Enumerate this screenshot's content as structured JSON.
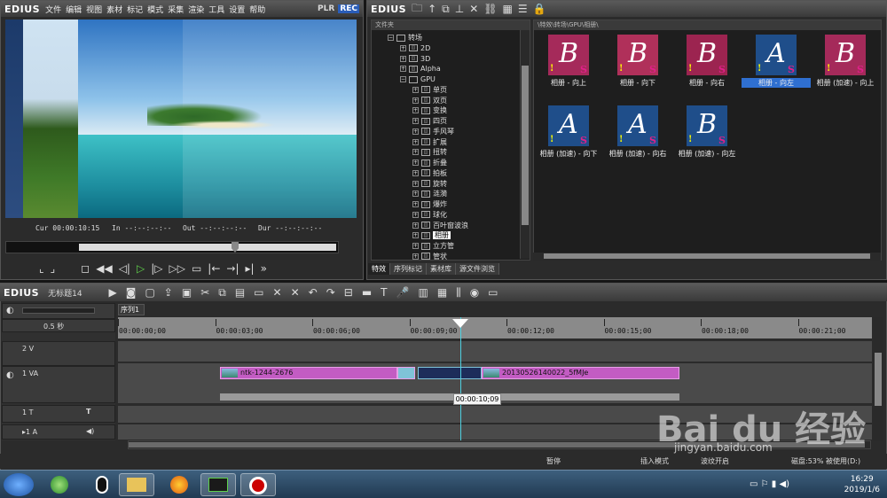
{
  "player": {
    "logo": "EDIUS",
    "menu": [
      "文件",
      "编辑",
      "视图",
      "素材",
      "标记",
      "模式",
      "采集",
      "渲染",
      "工具",
      "设置",
      "帮助"
    ],
    "plr": "PLR",
    "rec": "REC",
    "cur_label": "Cur",
    "cur": "00:00:10:15",
    "in_label": "In",
    "in": "--:--:--:--",
    "out_label": "Out",
    "out": "--:--:--:--",
    "dur_label": "Dur",
    "dur": "--:--:--:--"
  },
  "bin": {
    "logo": "EDIUS",
    "folder_header": "文件夹",
    "path": "\\特效\\转场\\GPU\\相册\\",
    "tree": [
      {
        "label": "转场",
        "indent": 0,
        "type": "folder"
      },
      {
        "label": "2D",
        "indent": 1,
        "type": "item"
      },
      {
        "label": "3D",
        "indent": 1,
        "type": "item"
      },
      {
        "label": "Alpha",
        "indent": 1,
        "type": "item"
      },
      {
        "label": "GPU",
        "indent": 1,
        "type": "folder"
      },
      {
        "label": "单页",
        "indent": 2,
        "type": "item"
      },
      {
        "label": "双页",
        "indent": 2,
        "type": "item"
      },
      {
        "label": "变换",
        "indent": 2,
        "type": "item"
      },
      {
        "label": "四页",
        "indent": 2,
        "type": "item"
      },
      {
        "label": "手风琴",
        "indent": 2,
        "type": "item"
      },
      {
        "label": "扩展",
        "indent": 2,
        "type": "item"
      },
      {
        "label": "扭转",
        "indent": 2,
        "type": "item"
      },
      {
        "label": "折叠",
        "indent": 2,
        "type": "item"
      },
      {
        "label": "拍板",
        "indent": 2,
        "type": "item"
      },
      {
        "label": "旋转",
        "indent": 2,
        "type": "item"
      },
      {
        "label": "涟漪",
        "indent": 2,
        "type": "item"
      },
      {
        "label": "爆炸",
        "indent": 2,
        "type": "item"
      },
      {
        "label": "球化",
        "indent": 2,
        "type": "item"
      },
      {
        "label": "百叶窗波浪",
        "indent": 2,
        "type": "item"
      },
      {
        "label": "相册",
        "indent": 2,
        "type": "item",
        "selected": true
      },
      {
        "label": "立方管",
        "indent": 2,
        "type": "item"
      },
      {
        "label": "管状",
        "indent": 2,
        "type": "item"
      }
    ],
    "clips": [
      {
        "label": "相册 - 向上",
        "letter": "B",
        "bg": "#a52a5a",
        "sel": false
      },
      {
        "label": "相册 - 向下",
        "letter": "B",
        "bg": "#b0305a",
        "sel": false
      },
      {
        "label": "相册 - 向右",
        "letter": "B",
        "bg": "#9c2450",
        "sel": false
      },
      {
        "label": "相册 - 向左",
        "letter": "A",
        "bg": "#1f4e8a",
        "sel": true
      },
      {
        "label": "相册 (加速) - 向上",
        "letter": "B",
        "bg": "#a52a5a",
        "sel": false
      },
      {
        "label": "相册 (加速) - 向下",
        "letter": "A",
        "bg": "#1f4e8a",
        "sel": false
      },
      {
        "label": "相册 (加速) - 向右",
        "letter": "A",
        "bg": "#1f4e8a",
        "sel": false
      },
      {
        "label": "相册 (加速) - 向左",
        "letter": "B",
        "bg": "#1f4e8a",
        "sel": false
      }
    ],
    "tabs": [
      "特效",
      "序列标记",
      "素材库",
      "源文件浏览"
    ]
  },
  "timeline": {
    "logo": "EDIUS",
    "title": "无标题14",
    "seq_tab": "序列1",
    "scale": "0.5 秒",
    "ruler": [
      "00:00:00;00",
      "00:00:03;00",
      "00:00:06;00",
      "00:00:09;00",
      "00:00:12;00",
      "00:00:15;00",
      "00:00:18;00",
      "00:00:21;00"
    ],
    "tracks": [
      {
        "name": "2 V"
      },
      {
        "name": "1 VA"
      },
      {
        "name": "1 T"
      },
      {
        "name": "▸1 A"
      }
    ],
    "clip1": "ntk-1244-2676",
    "clip2": "20130526140022_5fMJe",
    "tooltip": "00:00:10;09"
  },
  "status": {
    "pause": "暂停",
    "insert": "插入模式",
    "ripple": "波纹开启",
    "disk": "磁盘:53% 被使用(D:)"
  },
  "taskbar": {
    "time": "16:29",
    "date": "2019/1/6"
  },
  "watermark": {
    "main": "Bai du 经验",
    "sub": "jingyan.baidu.com"
  }
}
